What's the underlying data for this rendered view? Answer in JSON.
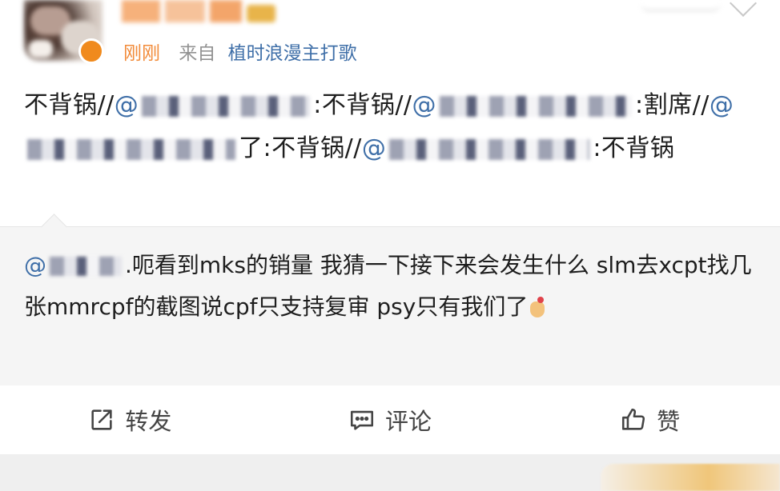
{
  "post": {
    "time": "刚刚",
    "from_label": "来自",
    "source": "植时浪漫主打歌",
    "text": {
      "p1": "不背锅//",
      "p2": "@",
      "p3": ":不背锅//",
      "p4": "@",
      "p5": ":割席//",
      "p6": "@",
      "p7": "了:不背锅//",
      "p8": "@",
      "p9": ":不背锅"
    }
  },
  "repost": {
    "mention_prefix": "@",
    "t1": ".",
    "t2": "呃看到mks的销量 我猜一下接下来会发生什么 slm去xcpt找几张mmrcpf的截图说cpf只支持复审 psy只有我们了"
  },
  "actions": {
    "repost": "转发",
    "comment": "评论",
    "like": "赞"
  },
  "icons": {
    "repost": "repost-icon",
    "comment": "comment-icon",
    "like": "thumbs-up-icon"
  },
  "colors": {
    "link": "#3f6fa8",
    "time": "#f28b3a",
    "quote_bg": "#f5f5f5"
  }
}
